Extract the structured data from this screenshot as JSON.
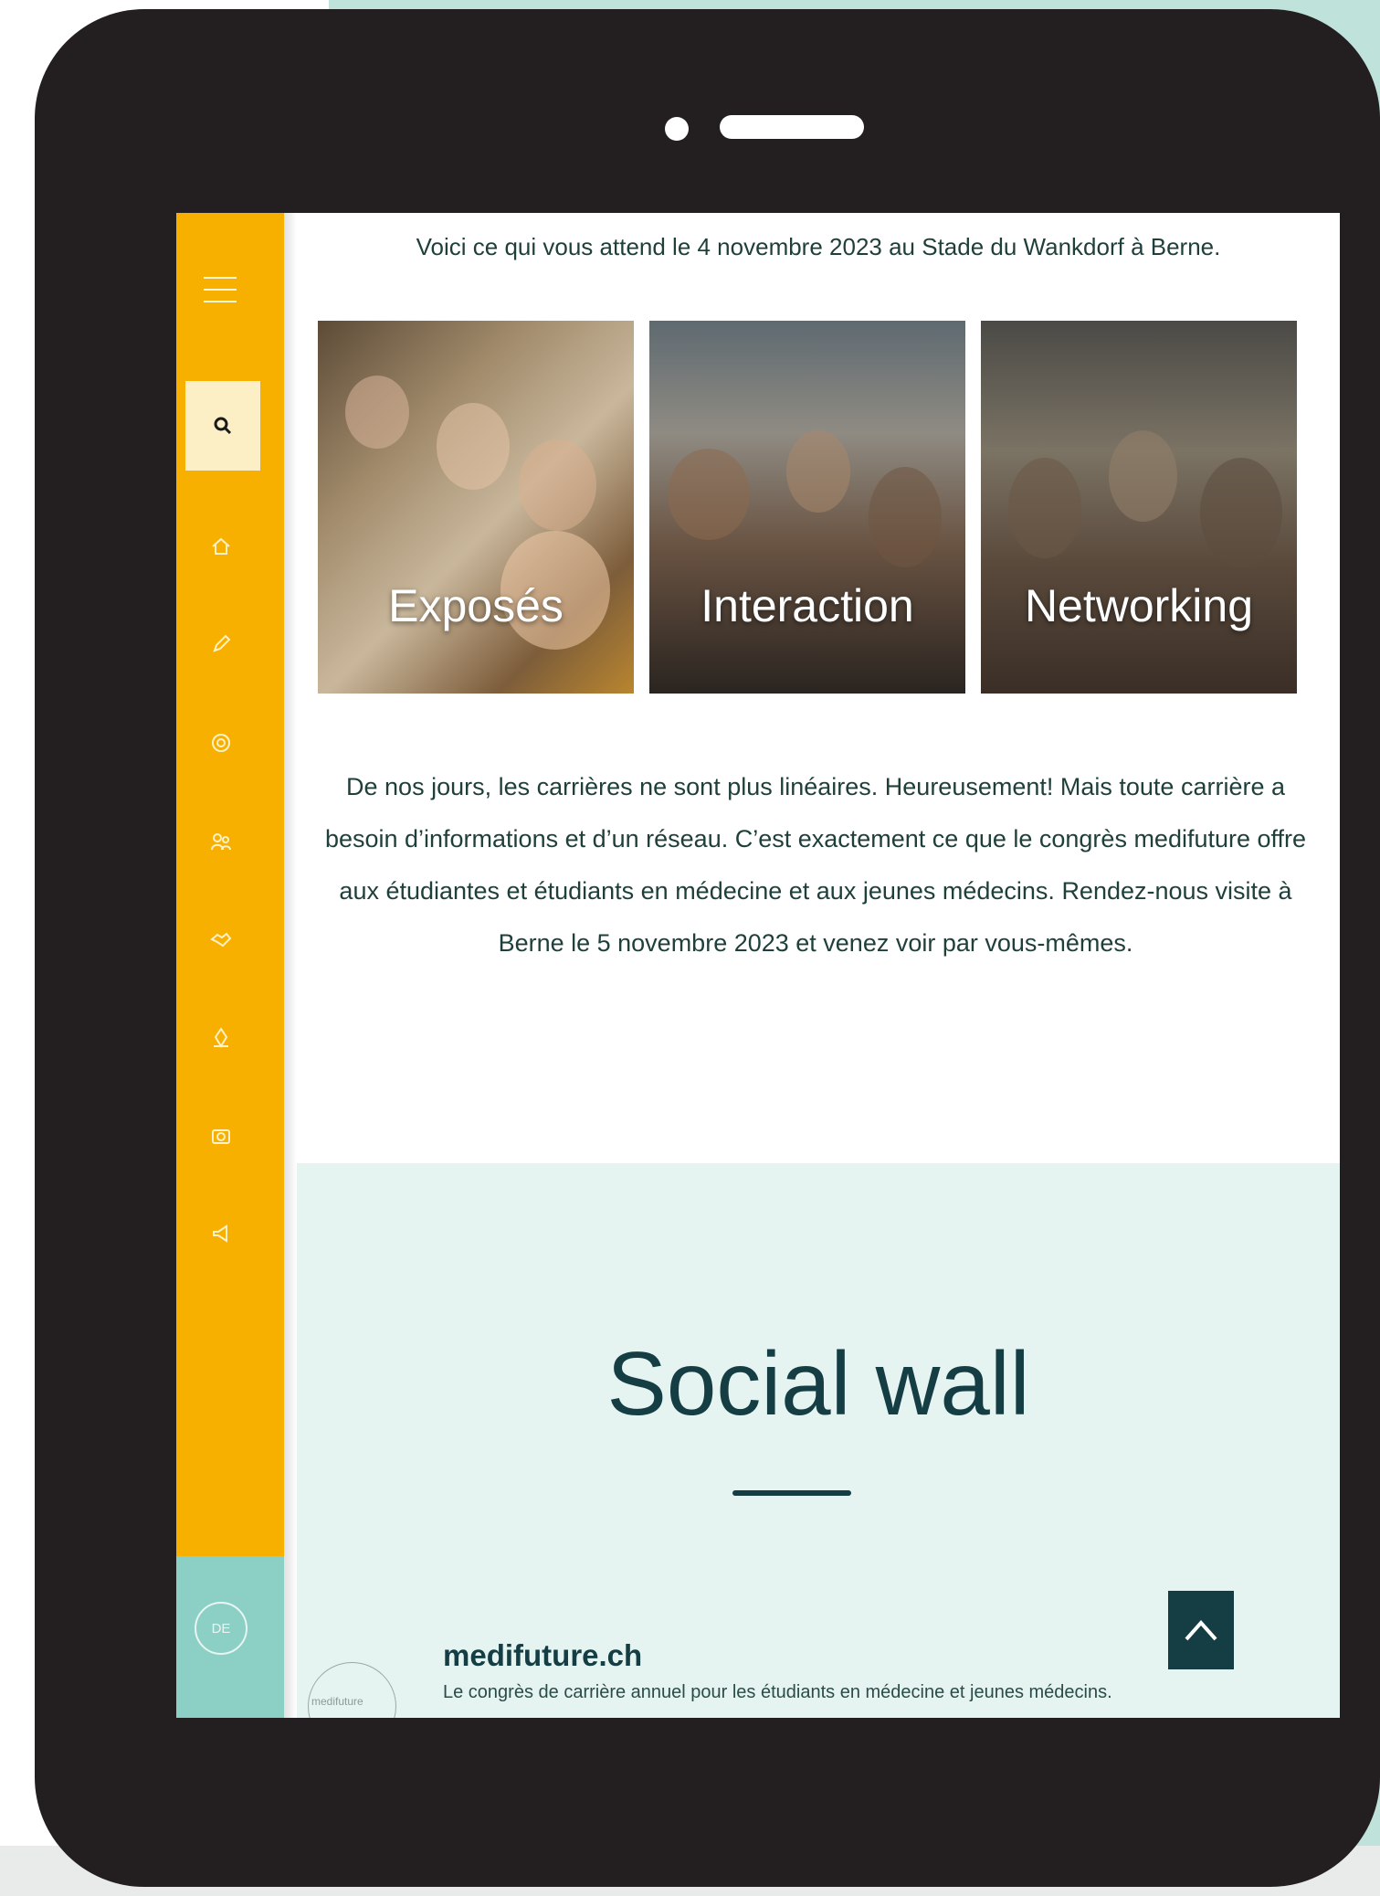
{
  "intro_text": "Voici ce qui vous attend le 4 novembre 2023 au Stade du Wankdorf à Berne.",
  "tiles": [
    {
      "caption": "Exposés"
    },
    {
      "caption": "Interaction"
    },
    {
      "caption": "Networking"
    }
  ],
  "description": "De nos jours, les carrières ne sont plus linéaires. Heureusement! Mais toute carrière a besoin d’informations et d’un réseau. C’est exactement ce que le congrès medifuture offre aux étudiantes et étudiants en médecine et aux jeunes médecins. Rendez-nous visite à Berne le 5 novembre 2023 et venez voir par vous-mêmes.",
  "social_wall": {
    "title": "Social wall",
    "footer": {
      "logo_text": "medifuture",
      "site_name": "medifuture.ch",
      "tagline": "Le congrès de carrière annuel pour les étudiants en médecine et jeunes médecins."
    }
  },
  "sidebar": {
    "language": "DE",
    "icons": [
      "home-icon",
      "pencil-icon",
      "coin-icon",
      "people-icon",
      "handshake-icon",
      "pin-icon",
      "camera-icon",
      "announcement-icon"
    ]
  },
  "colors": {
    "sidebar": "#f8b000",
    "teal_background": "#bfe3da",
    "social_background": "#e6f4f1",
    "dark_teal": "#143d44"
  }
}
